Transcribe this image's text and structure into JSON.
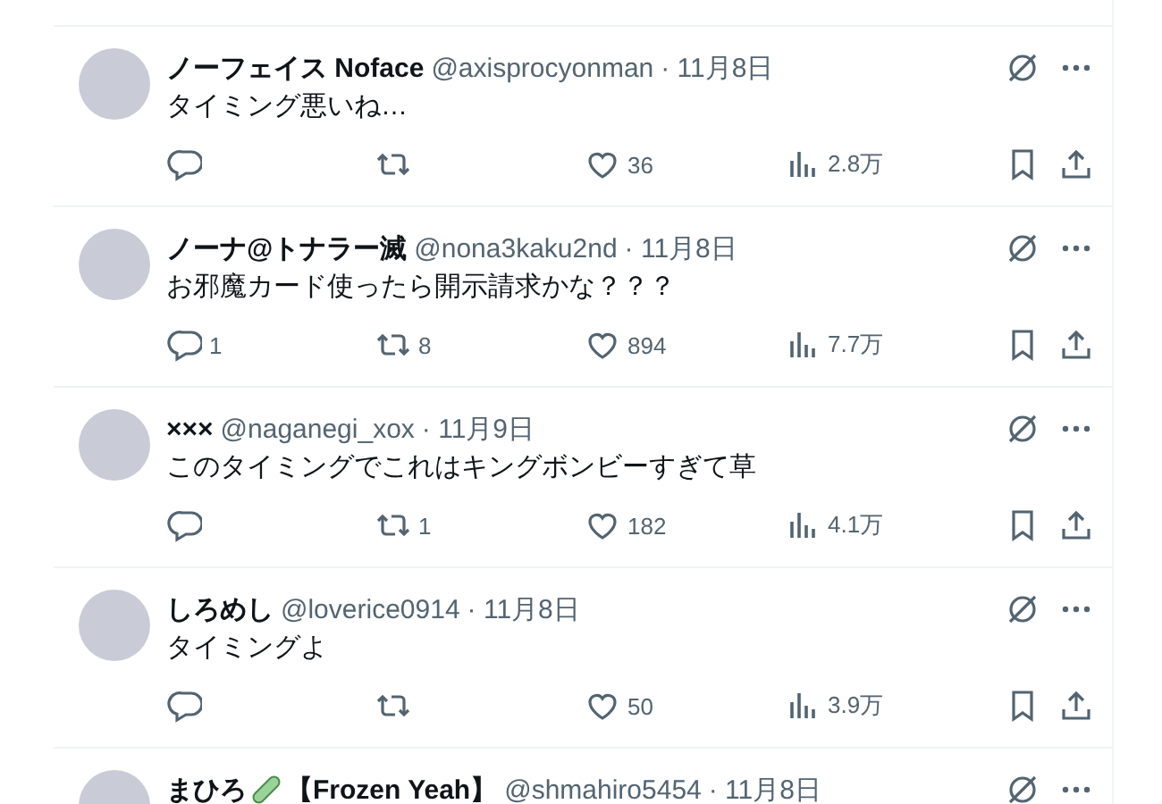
{
  "posts": [
    {
      "name": "ノーフェイス Noface",
      "handle": "@axisprocyonman",
      "date": "· 11月8日",
      "text": "タイミング悪いね…",
      "likes": "36",
      "views": "2.8万"
    },
    {
      "name": "ノーナ@トナラー滅",
      "handle": "@nona3kaku2nd",
      "date": "· 11月8日",
      "text": "お邪魔カード使ったら開示請求かな？？？",
      "replies": "1",
      "reposts": "8",
      "likes": "894",
      "views": "7.7万"
    },
    {
      "name": "×××",
      "handle": "@naganegi_xox",
      "date": "· 11月9日",
      "text": "このタイミングでこれはキングボンビーすぎて草",
      "reposts": "1",
      "likes": "182",
      "views": "4.1万"
    },
    {
      "name": "しろめし",
      "handle": "@loverice0914",
      "date": "· 11月8日",
      "text": "タイミングよ",
      "likes": "50",
      "views": "3.9万"
    },
    {
      "name": "まひろ",
      "name_suffix": "【Frozen Yeah】",
      "handle": "@shmahiro5454",
      "date": "· 11月8日"
    }
  ]
}
